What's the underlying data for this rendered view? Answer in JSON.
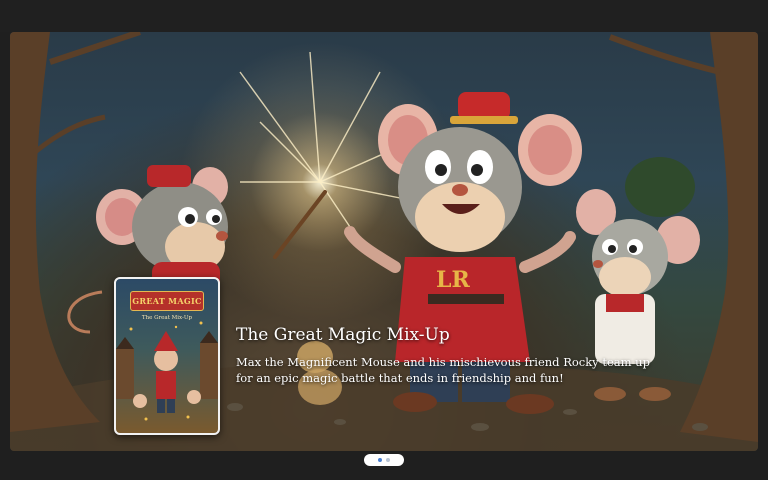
{
  "hero": {
    "title": "The Great Magic Mix-Up",
    "description": "Max the Magnificent Mouse and his mischievous friend Rocky team up for an epic magic battle that ends in friendship and fun!",
    "cover": {
      "title": "GREAT MAGIC",
      "subtitle": "The Great Mix-Up"
    },
    "shirt_letters": "LR"
  },
  "carousel": {
    "slide_count": 2,
    "active_index": 0
  },
  "colors": {
    "page_background": "#1f1f1f",
    "pager_active": "#4a7fd0",
    "pager_inactive": "#b8c4d4"
  }
}
